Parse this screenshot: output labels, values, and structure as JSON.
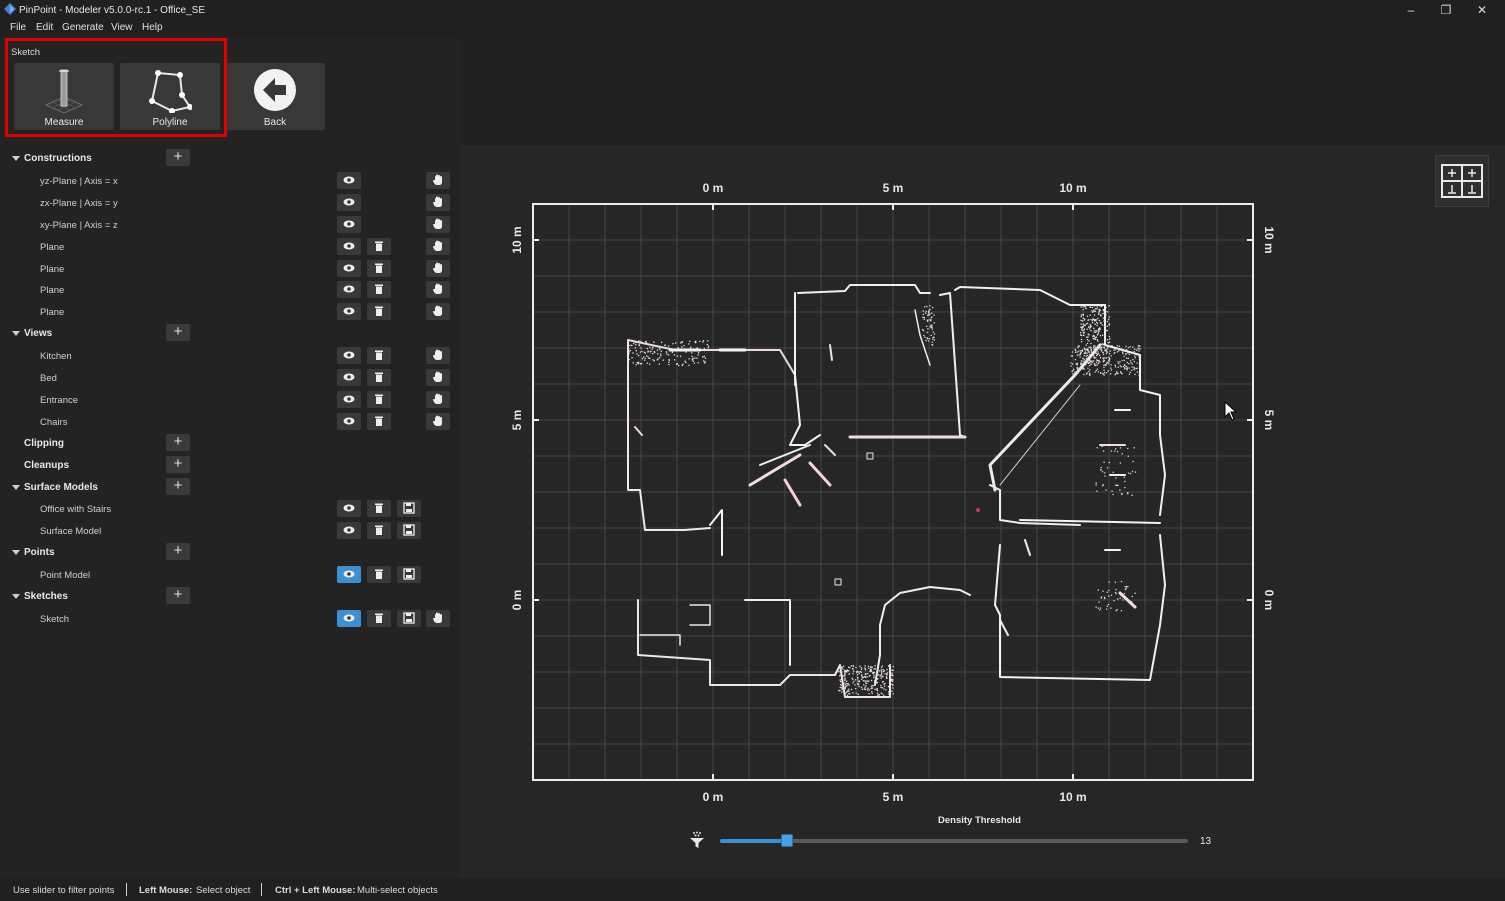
{
  "window": {
    "title": "PinPoint - Modeler v5.0.0-rc.1 - Office_SE",
    "minimize": "–",
    "restore": "❐",
    "close": "✕"
  },
  "menu": [
    "File",
    "Edit",
    "Generate",
    "View",
    "Help"
  ],
  "toolbar": {
    "group_label": "Sketch",
    "buttons": [
      {
        "label": "Measure",
        "icon": "measure-icon"
      },
      {
        "label": "Polyline",
        "icon": "polyline-icon"
      },
      {
        "label": "Back",
        "icon": "back-arrow-icon"
      }
    ]
  },
  "tree": {
    "sections": [
      {
        "name": "Constructions",
        "items": [
          "yz-Plane | Axis = x",
          "zx-Plane | Axis = y",
          "xy-Plane | Axis = z",
          "Plane",
          "Plane",
          "Plane",
          "Plane"
        ]
      },
      {
        "name": "Views",
        "items": [
          "Kitchen",
          "Bed",
          "Entrance",
          "Chairs"
        ]
      },
      {
        "name": "Clipping",
        "items": []
      },
      {
        "name": "Cleanups",
        "items": []
      },
      {
        "name": "Surface Models",
        "items": [
          "Office with Stairs",
          "Surface Model"
        ]
      },
      {
        "name": "Points",
        "items": [
          "Point Model"
        ]
      },
      {
        "name": "Sketches",
        "items": [
          "Sketch"
        ]
      }
    ]
  },
  "plot": {
    "top_ticks": [
      "0 m",
      "5 m",
      "10 m"
    ],
    "bottom_ticks": [
      "0 m",
      "5 m",
      "10 m"
    ],
    "left_ticks": [
      "10 m",
      "5 m",
      "0 m"
    ],
    "right_ticks": [
      "10 m",
      "5 m",
      "0 m"
    ]
  },
  "density": {
    "label": "Density Threshold",
    "value": "13",
    "fraction": 0.144
  },
  "status": {
    "hint": "Use slider to filter points",
    "left_mouse_key": "Left Mouse:",
    "left_mouse_action": "Select object",
    "ctrl_key": "Ctrl + Left Mouse:",
    "ctrl_action": "Multi-select objects"
  },
  "colors": {
    "accent": "#3c8fd0",
    "highlight": "#e00000",
    "background": "#202020"
  }
}
